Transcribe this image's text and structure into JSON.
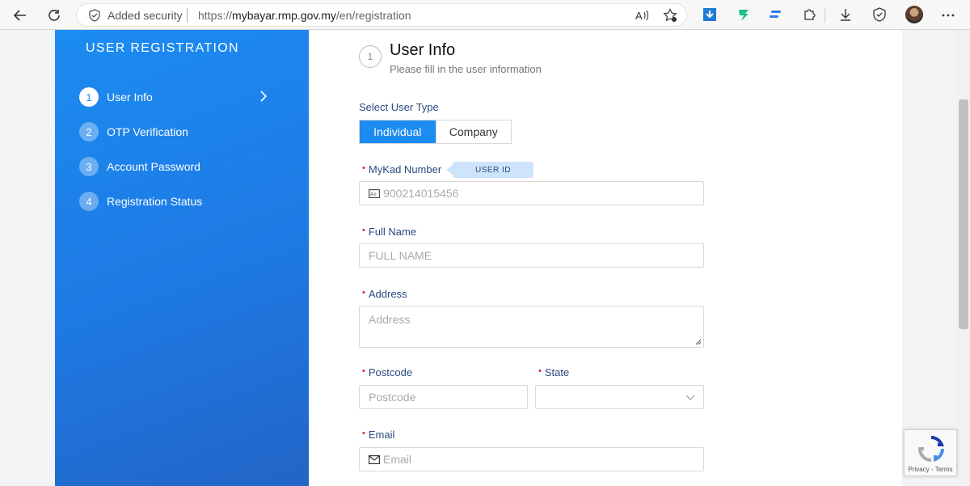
{
  "browser": {
    "security_label": "Added security",
    "url_prefix": "https://",
    "url_domain": "mybayar.rmp.gov.my",
    "url_path": "/en/registration"
  },
  "sidebar": {
    "title": "USER REGISTRATION",
    "steps": [
      {
        "num": "1",
        "label": "User Info"
      },
      {
        "num": "2",
        "label": "OTP Verification"
      },
      {
        "num": "3",
        "label": "Account Password"
      },
      {
        "num": "4",
        "label": "Registration Status"
      }
    ]
  },
  "header": {
    "step_num": "1",
    "title": "User Info",
    "subtitle": "Please fill in the user information"
  },
  "form": {
    "user_type_label": "Select User Type",
    "user_types": [
      "Individual",
      "Company"
    ],
    "selected_user_type": "Individual",
    "mykad_label": "MyKad Number",
    "mykad_tag": "USER ID",
    "mykad_placeholder": "900214015456",
    "fullname_label": "Full Name",
    "fullname_placeholder": "FULL NAME",
    "address_label": "Address",
    "address_placeholder": "Address",
    "postcode_label": "Postcode",
    "postcode_placeholder": "Postcode",
    "state_label": "State",
    "state_value": "",
    "email_label": "Email",
    "email_placeholder": "Email",
    "required_mark": "•"
  },
  "recaptcha": {
    "text": "Privacy - Terms"
  },
  "colors": {
    "primary": "#1c8cf2",
    "label": "#2a4a7f",
    "required": "#e02020"
  }
}
